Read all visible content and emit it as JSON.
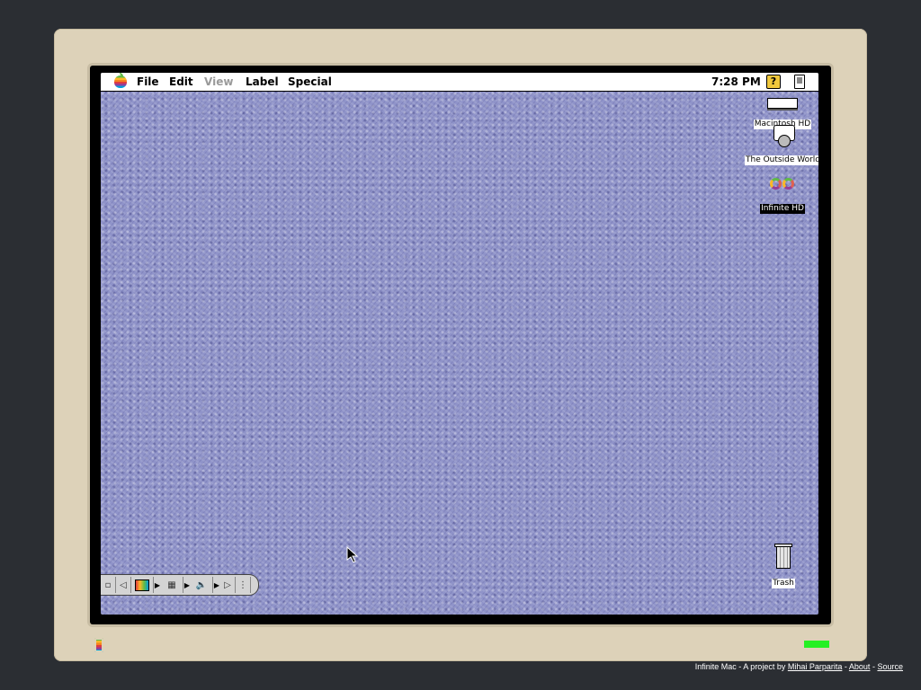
{
  "menubar": {
    "items": [
      {
        "label": "File",
        "enabled": true
      },
      {
        "label": "Edit",
        "enabled": true
      },
      {
        "label": "View",
        "enabled": false
      },
      {
        "label": "Label",
        "enabled": true
      },
      {
        "label": "Special",
        "enabled": true
      }
    ],
    "clock": "7:28 PM",
    "help_icon": "?"
  },
  "desktop_icons": {
    "macintosh_hd": "Macintosh HD",
    "outside_world": "The Outside World",
    "infinite_hd": "Infinite HD",
    "trash": "Trash"
  },
  "footer": {
    "prefix": "Infinite Mac - A project by",
    "author": "Mihai Parparita",
    "sep1": "-",
    "about": "About",
    "sep2": "-",
    "source": "Source"
  },
  "colors": {
    "desktop": "#8f93c9",
    "monitor": "#ddd2b9",
    "power_led": "#24f024",
    "page_background": "#2b2e33"
  }
}
